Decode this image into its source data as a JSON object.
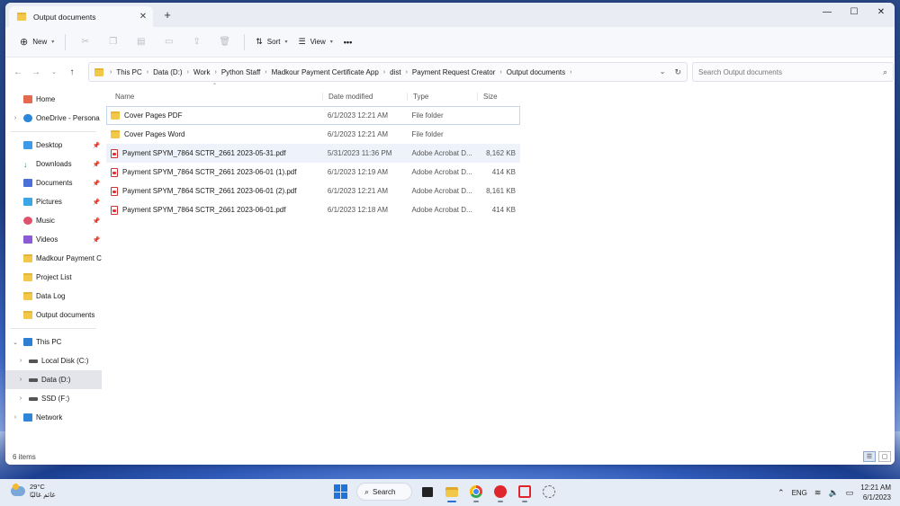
{
  "window": {
    "tab_title": "Output documents",
    "tab_close": "✕",
    "new_tab": "+",
    "controls": {
      "minimize": "—",
      "maximize": "☐",
      "close": "✕"
    }
  },
  "toolbar": {
    "new_label": "New",
    "sort_label": "Sort",
    "view_label": "View",
    "more": "•••"
  },
  "address": {
    "crumbs": [
      "This PC",
      "Data (D:)",
      "Work",
      "Python Staff",
      "Madkour Payment Certificate App",
      "dist",
      "Payment Request Creator",
      "Output documents"
    ],
    "search_placeholder": "Search Output documents"
  },
  "nav": {
    "home": "Home",
    "onedrive": "OneDrive - Persona",
    "quick": [
      {
        "label": "Desktop",
        "icon": "desktop-icon"
      },
      {
        "label": "Downloads",
        "icon": "download-icon"
      },
      {
        "label": "Documents",
        "icon": "documents-icon"
      },
      {
        "label": "Pictures",
        "icon": "pictures-icon"
      },
      {
        "label": "Music",
        "icon": "music-icon"
      },
      {
        "label": "Videos",
        "icon": "videos-icon"
      },
      {
        "label": "Madkour Payment C",
        "icon": "folder-icon"
      },
      {
        "label": "Project List",
        "icon": "folder-icon"
      },
      {
        "label": "Data Log",
        "icon": "folder-icon"
      },
      {
        "label": "Output documents",
        "icon": "folder-icon"
      }
    ],
    "this_pc": "This PC",
    "drives": [
      "Local Disk (C:)",
      "Data (D:)",
      "SSD (F:)"
    ],
    "network": "Network"
  },
  "columns": {
    "name": "Name",
    "date": "Date modified",
    "type": "Type",
    "size": "Size"
  },
  "files": [
    {
      "name": "Cover Pages PDF",
      "date": "6/1/2023 12:21 AM",
      "type": "File folder",
      "size": "",
      "kind": "folder"
    },
    {
      "name": "Cover Pages Word",
      "date": "6/1/2023 12:21 AM",
      "type": "File folder",
      "size": "",
      "kind": "folder"
    },
    {
      "name": "Payment SPYM_7864 SCTR_2661 2023-05-31.pdf",
      "date": "5/31/2023 11:36 PM",
      "type": "Adobe Acrobat D...",
      "size": "8,162 KB",
      "kind": "pdf"
    },
    {
      "name": "Payment SPYM_7864 SCTR_2661 2023-06-01 (1).pdf",
      "date": "6/1/2023 12:19 AM",
      "type": "Adobe Acrobat D...",
      "size": "414 KB",
      "kind": "pdf"
    },
    {
      "name": "Payment SPYM_7864 SCTR_2661 2023-06-01 (2).pdf",
      "date": "6/1/2023 12:21 AM",
      "type": "Adobe Acrobat D...",
      "size": "8,161 KB",
      "kind": "pdf"
    },
    {
      "name": "Payment SPYM_7864 SCTR_2661 2023-06-01.pdf",
      "date": "6/1/2023 12:18 AM",
      "type": "Adobe Acrobat D...",
      "size": "414 KB",
      "kind": "pdf"
    }
  ],
  "status": {
    "count": "6 items"
  },
  "taskbar": {
    "temp": "29°C",
    "weather_desc": "غائم غالبًا",
    "search": "Search",
    "lang": "ENG",
    "time": "12:21 AM",
    "date": "6/1/2023"
  }
}
